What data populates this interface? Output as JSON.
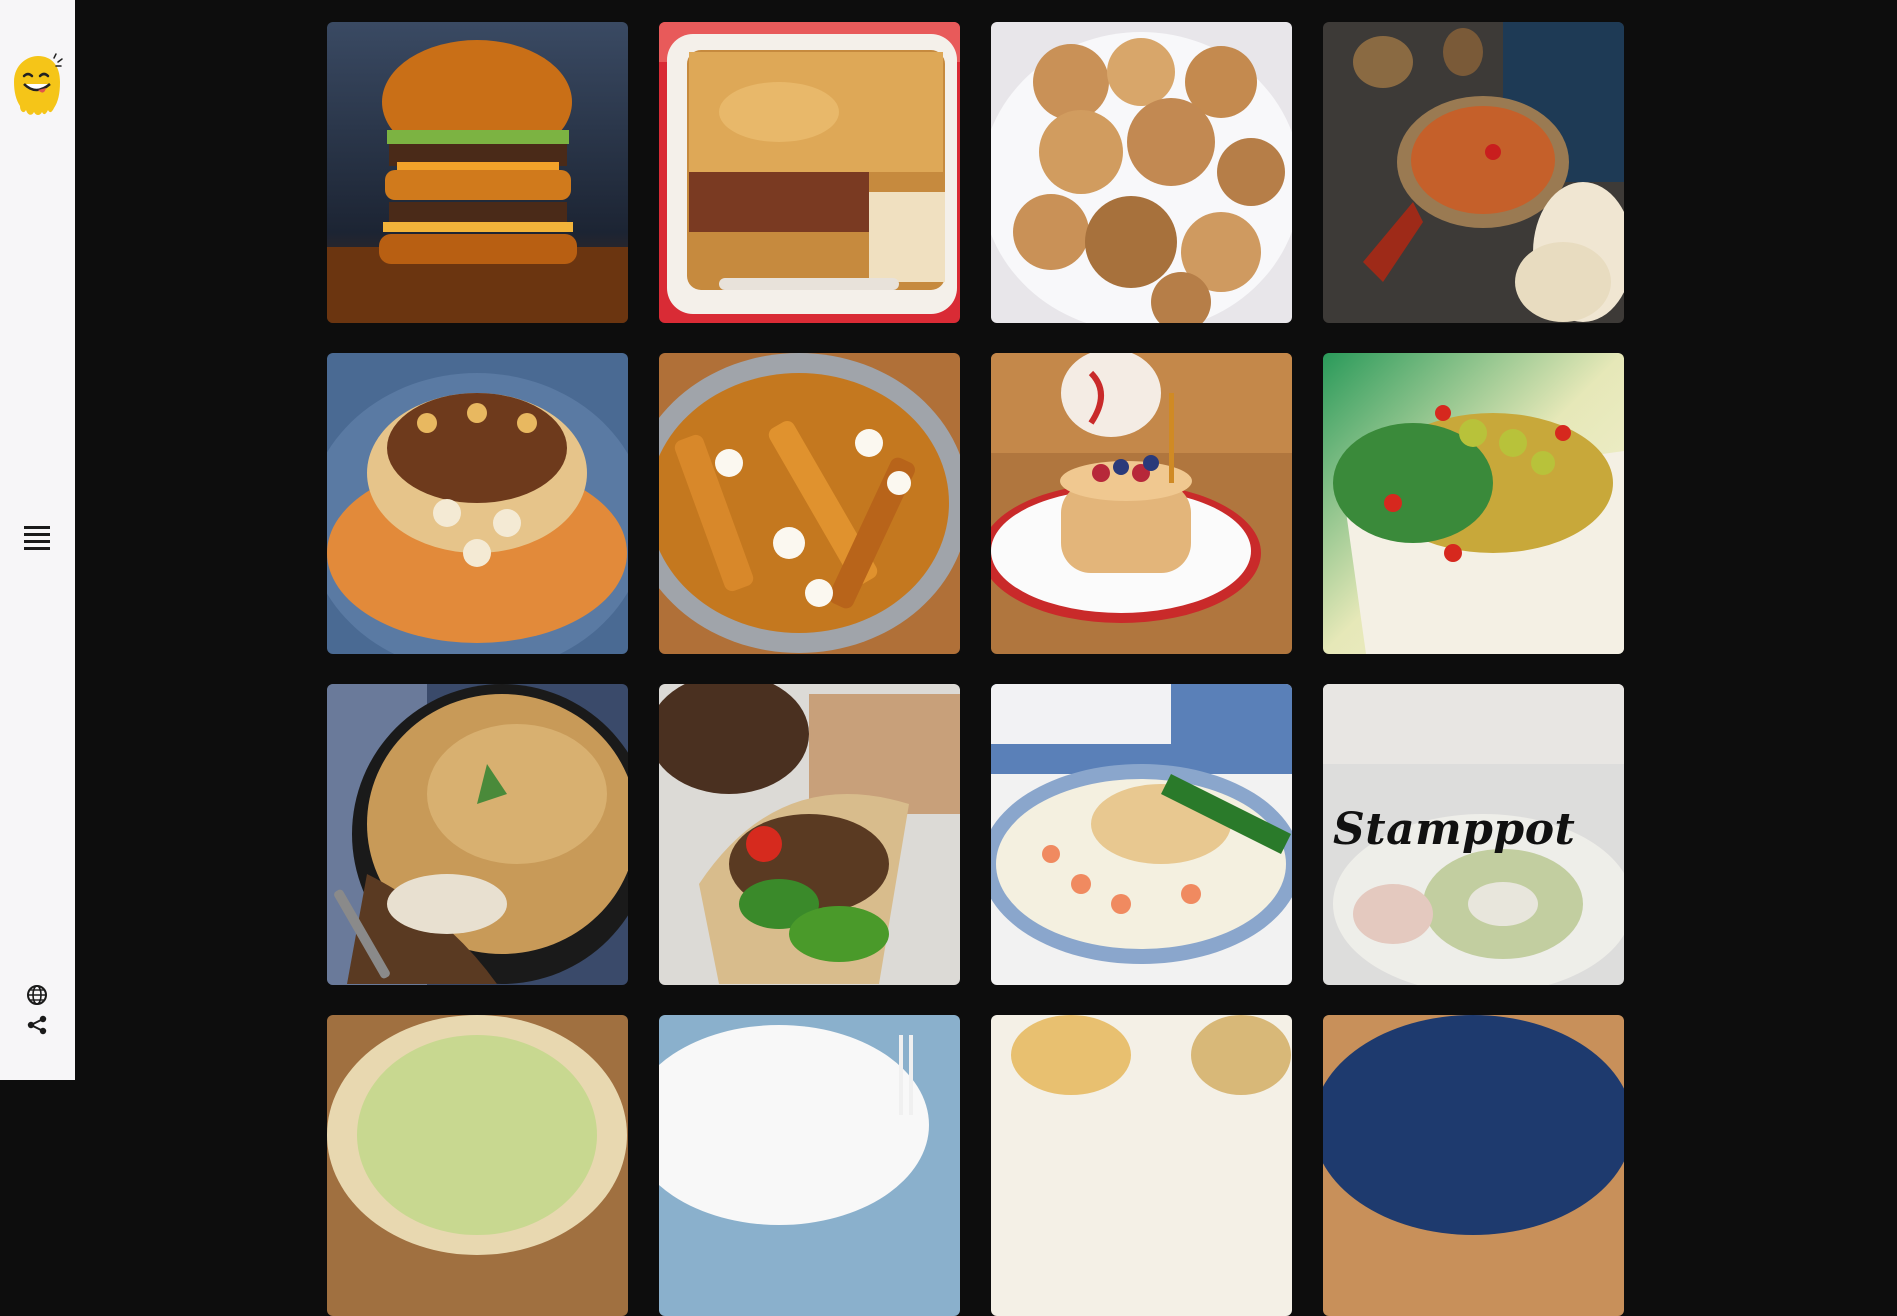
{
  "sidebar": {
    "icons": [
      "mascot-logo",
      "menu-icon",
      "globe-icon",
      "share-icon"
    ]
  },
  "dishes": [
    {
      "name": "burger"
    },
    {
      "name": "lasagna"
    },
    {
      "name": "sugar-fritters"
    },
    {
      "name": "lentil-soup"
    },
    {
      "name": "koshari"
    },
    {
      "name": "poutine"
    },
    {
      "name": "pancakes"
    },
    {
      "name": "loaded-nachos"
    },
    {
      "name": "moussaka"
    },
    {
      "name": "shawarma-wrap"
    },
    {
      "name": "fish-pie"
    },
    {
      "name": "stamppot",
      "label": "Stamppot"
    },
    {
      "name": "quiche"
    },
    {
      "name": "plated-dish"
    },
    {
      "name": "bread-dish"
    },
    {
      "name": "blue-plate-dish"
    }
  ],
  "colors": {
    "sidebar_bg": "#f7f6f8",
    "page_bg": "#0d0d0d",
    "mascot": "#f5c518"
  }
}
